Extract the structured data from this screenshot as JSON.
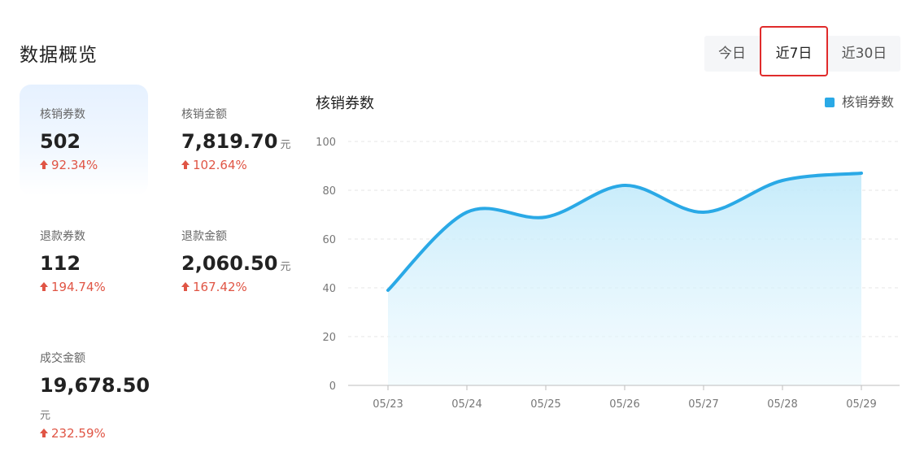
{
  "header": {
    "title": "数据概览"
  },
  "range_tabs": [
    {
      "label": "今日"
    },
    {
      "label": "近7日"
    },
    {
      "label": "近30日"
    }
  ],
  "range_tabs_selected": "近7日",
  "stats": [
    {
      "label": "核销券数",
      "value": "502",
      "unit": "",
      "change": "92.34%"
    },
    {
      "label": "核销金额",
      "value": "7,819.70",
      "unit": "元",
      "change": "102.64%"
    },
    {
      "label": "退款券数",
      "value": "112",
      "unit": "",
      "change": "194.74%"
    },
    {
      "label": "退款金额",
      "value": "2,060.50",
      "unit": "元",
      "change": "167.42%"
    },
    {
      "label": "成交金额",
      "value": "19,678.50",
      "unit": "元",
      "change": "232.59%"
    }
  ],
  "chart": {
    "title": "核销券数",
    "legend_label": "核销券数",
    "color": "#2aa9e6"
  },
  "chart_data": {
    "type": "area",
    "title": "核销券数",
    "categories": [
      "05/23",
      "05/24",
      "05/25",
      "05/26",
      "05/27",
      "05/28",
      "05/29"
    ],
    "series": [
      {
        "name": "核销券数",
        "values": [
          39,
          71,
          69,
          82,
          71,
          84,
          87
        ]
      }
    ],
    "y_ticks": [
      0,
      20,
      40,
      60,
      80,
      100
    ],
    "ylim": [
      0,
      100
    ],
    "grid": true,
    "legend_position": "top-right"
  }
}
